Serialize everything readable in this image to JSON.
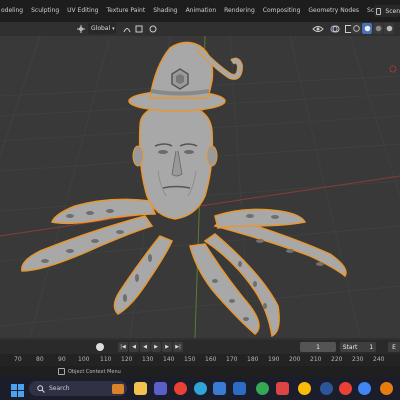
{
  "workspace_tabs": [
    "odeling",
    "Sculpting",
    "UV Editing",
    "Texture Paint",
    "Shading",
    "Animation",
    "Rendering",
    "Compositing",
    "Geometry Nodes",
    "Scripting"
  ],
  "add_tab_glyph": "+",
  "scene_label": "Scen",
  "header": {
    "orientation_value": "Global",
    "icons": [
      "transform-orientation-icon",
      "pivot-icon",
      "snap-icon",
      "proportional-edit-icon",
      "visibility-icon",
      "gizmo-icon",
      "overlay-icon",
      "xray-icon",
      "shading-wire-icon",
      "shading-solid-icon",
      "shading-material-icon",
      "shading-rendered-icon"
    ]
  },
  "timeline": {
    "current_frame": "1",
    "start_label": "Start",
    "start_value": "1",
    "end_value": "E"
  },
  "ruler_ticks": [
    "70",
    "80",
    "90",
    "100",
    "110",
    "120",
    "130",
    "140",
    "150",
    "160",
    "170",
    "180",
    "190",
    "200",
    "210",
    "220",
    "230",
    "240"
  ],
  "status": {
    "context_menu_label": "Object Context Menu"
  },
  "taskbar": {
    "search_placeholder": "Search",
    "icons": [
      "start-icon",
      "search-icon",
      "file-explorer-icon",
      "teams-icon",
      "chrome-icon",
      "edge-icon",
      "store-icon",
      "photos-icon",
      "chrome-icon",
      "media-icon",
      "paint-icon",
      "chrome-icon",
      "word-icon",
      "chrome-icon",
      "explorer-icon",
      "chrome-icon",
      "blender-icon"
    ]
  },
  "colors": {
    "selection_outline": "#e8962e",
    "model_gray": "#a8a8a8",
    "grid_red_axis": "#8a3a3a",
    "grid_green_axis": "#5a7a2f",
    "taskbar_bg": "#1b1d2b"
  }
}
